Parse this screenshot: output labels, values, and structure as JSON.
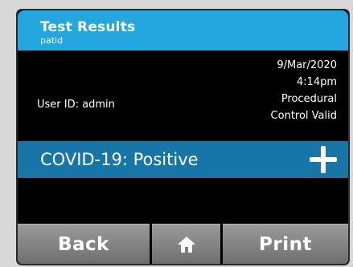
{
  "header": {
    "title": "Test Results",
    "subtitle": "patid"
  },
  "meta": {
    "date": "9/Mar/2020",
    "time": "4:14pm",
    "control_line1": "Procedural",
    "control_line2": "Control Valid",
    "user_id": "User ID: admin"
  },
  "result": {
    "text": "COVID-19: Positive",
    "indicator_icon": "plus-icon"
  },
  "footer": {
    "back_label": "Back",
    "home_icon": "home-icon",
    "print_label": "Print"
  },
  "colors": {
    "header_bg": "#24a7de",
    "result_bg": "#1775a7",
    "button_bg": "#8a8a8a"
  }
}
